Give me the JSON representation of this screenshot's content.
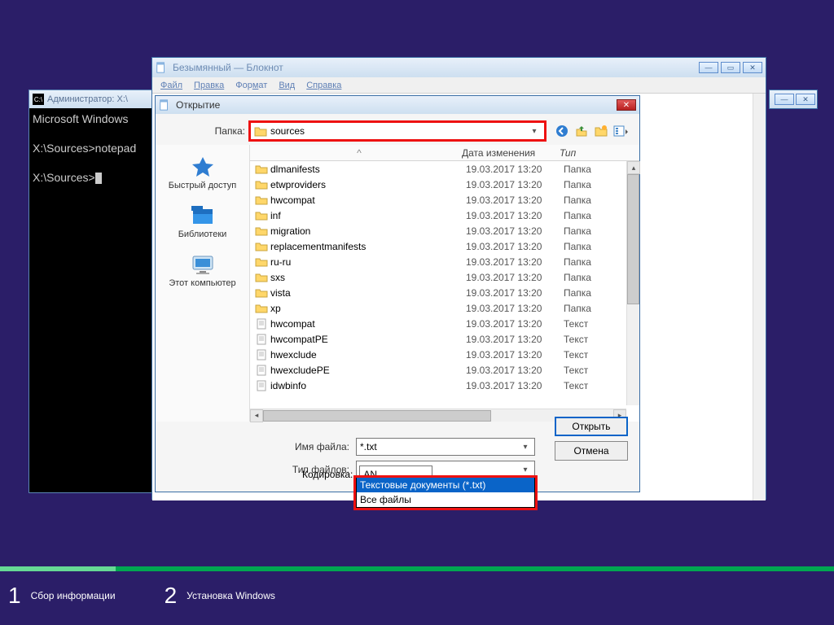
{
  "footer": {
    "step1_num": "1",
    "step1_label": "Сбор информации",
    "step2_num": "2",
    "step2_label": "Установка Windows"
  },
  "cmd": {
    "title": "Администратор: X:\\",
    "line1": "Microsoft Windows",
    "line2": "X:\\Sources>notepad",
    "line3": "X:\\Sources>"
  },
  "notepad": {
    "title": "Безымянный — Блокнот",
    "menu": {
      "file": "Файл",
      "edit": "Правка",
      "format": "Формат",
      "view": "Вид",
      "help": "Справка"
    }
  },
  "opendlg": {
    "title": "Открытие",
    "folder_label": "Папка:",
    "folder_value": "sources",
    "places": {
      "quick": "Быстрый доступ",
      "libs": "Библиотеки",
      "pc": "Этот компьютер"
    },
    "headers": {
      "name_sort": "^",
      "date": "Дата изменения",
      "type": "Тип"
    },
    "rows": [
      {
        "icon": "folder",
        "name": "dlmanifests",
        "date": "19.03.2017 13:20",
        "type": "Папка"
      },
      {
        "icon": "folder",
        "name": "etwproviders",
        "date": "19.03.2017 13:20",
        "type": "Папка"
      },
      {
        "icon": "folder",
        "name": "hwcompat",
        "date": "19.03.2017 13:20",
        "type": "Папка"
      },
      {
        "icon": "folder",
        "name": "inf",
        "date": "19.03.2017 13:20",
        "type": "Папка"
      },
      {
        "icon": "folder",
        "name": "migration",
        "date": "19.03.2017 13:20",
        "type": "Папка"
      },
      {
        "icon": "folder",
        "name": "replacementmanifests",
        "date": "19.03.2017 13:20",
        "type": "Папка"
      },
      {
        "icon": "folder",
        "name": "ru-ru",
        "date": "19.03.2017 13:20",
        "type": "Папка"
      },
      {
        "icon": "folder",
        "name": "sxs",
        "date": "19.03.2017 13:20",
        "type": "Папка"
      },
      {
        "icon": "folder",
        "name": "vista",
        "date": "19.03.2017 13:20",
        "type": "Папка"
      },
      {
        "icon": "folder",
        "name": "xp",
        "date": "19.03.2017 13:20",
        "type": "Папка"
      },
      {
        "icon": "txt",
        "name": "hwcompat",
        "date": "19.03.2017 13:20",
        "type": "Текст"
      },
      {
        "icon": "txt",
        "name": "hwcompatPE",
        "date": "19.03.2017 13:20",
        "type": "Текст"
      },
      {
        "icon": "txt",
        "name": "hwexclude",
        "date": "19.03.2017 13:20",
        "type": "Текст"
      },
      {
        "icon": "txt",
        "name": "hwexcludePE",
        "date": "19.03.2017 13:20",
        "type": "Текст"
      },
      {
        "icon": "txt",
        "name": "idwbinfo",
        "date": "19.03.2017 13:20",
        "type": "Текст"
      }
    ],
    "filename_label": "Имя файла:",
    "filename_value": "*.txt",
    "filetype_label": "Тип файлов:",
    "filetype_selected": "Текстовые документы (*.txt)",
    "filetype_opt1": "Текстовые документы (*.txt)",
    "filetype_opt2": "Все файлы",
    "encoding_label": "Кодировка:",
    "encoding_value": "ANSI",
    "open_btn": "Открыть",
    "cancel_btn": "Отмена"
  }
}
